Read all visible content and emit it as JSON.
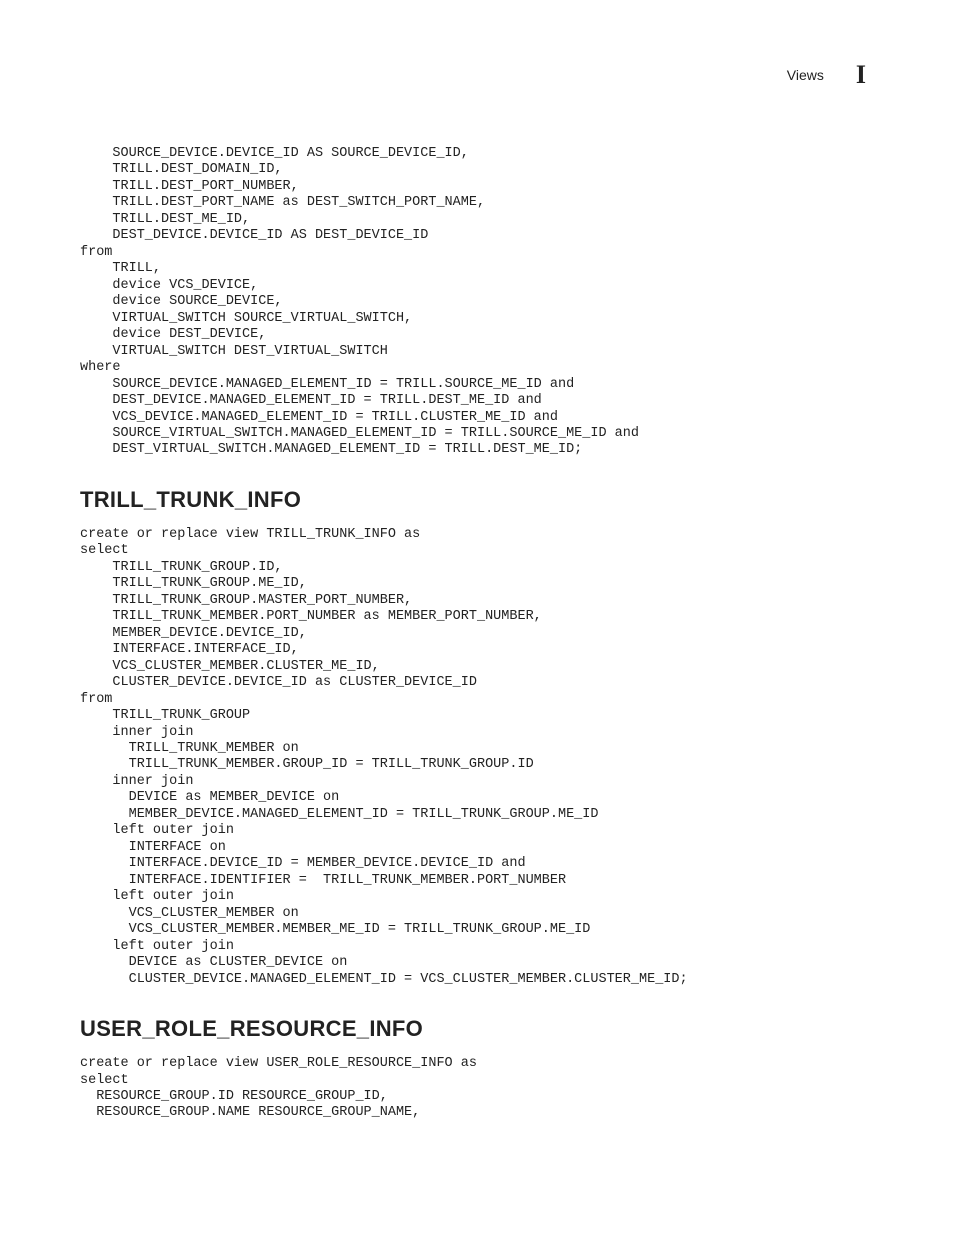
{
  "header": {
    "section": "Views",
    "appendix_letter": "I"
  },
  "code_block_1": "    SOURCE_DEVICE.DEVICE_ID AS SOURCE_DEVICE_ID,\n    TRILL.DEST_DOMAIN_ID,\n    TRILL.DEST_PORT_NUMBER,\n    TRILL.DEST_PORT_NAME as DEST_SWITCH_PORT_NAME,\n    TRILL.DEST_ME_ID,\n    DEST_DEVICE.DEVICE_ID AS DEST_DEVICE_ID\nfrom\n    TRILL,\n    device VCS_DEVICE,\n    device SOURCE_DEVICE,\n    VIRTUAL_SWITCH SOURCE_VIRTUAL_SWITCH,\n    device DEST_DEVICE,\n    VIRTUAL_SWITCH DEST_VIRTUAL_SWITCH\nwhere\n    SOURCE_DEVICE.MANAGED_ELEMENT_ID = TRILL.SOURCE_ME_ID and\n    DEST_DEVICE.MANAGED_ELEMENT_ID = TRILL.DEST_ME_ID and\n    VCS_DEVICE.MANAGED_ELEMENT_ID = TRILL.CLUSTER_ME_ID and\n    SOURCE_VIRTUAL_SWITCH.MANAGED_ELEMENT_ID = TRILL.SOURCE_ME_ID and\n    DEST_VIRTUAL_SWITCH.MANAGED_ELEMENT_ID = TRILL.DEST_ME_ID;",
  "heading_1": "TRILL_TRUNK_INFO",
  "code_block_2": "create or replace view TRILL_TRUNK_INFO as\nselect\n    TRILL_TRUNK_GROUP.ID,\n    TRILL_TRUNK_GROUP.ME_ID,\n    TRILL_TRUNK_GROUP.MASTER_PORT_NUMBER,\n    TRILL_TRUNK_MEMBER.PORT_NUMBER as MEMBER_PORT_NUMBER,\n    MEMBER_DEVICE.DEVICE_ID,\n    INTERFACE.INTERFACE_ID,\n    VCS_CLUSTER_MEMBER.CLUSTER_ME_ID,\n    CLUSTER_DEVICE.DEVICE_ID as CLUSTER_DEVICE_ID\nfrom\n    TRILL_TRUNK_GROUP\n    inner join\n      TRILL_TRUNK_MEMBER on\n      TRILL_TRUNK_MEMBER.GROUP_ID = TRILL_TRUNK_GROUP.ID\n    inner join\n      DEVICE as MEMBER_DEVICE on\n      MEMBER_DEVICE.MANAGED_ELEMENT_ID = TRILL_TRUNK_GROUP.ME_ID\n    left outer join\n      INTERFACE on\n      INTERFACE.DEVICE_ID = MEMBER_DEVICE.DEVICE_ID and\n      INTERFACE.IDENTIFIER =  TRILL_TRUNK_MEMBER.PORT_NUMBER\n    left outer join\n      VCS_CLUSTER_MEMBER on\n      VCS_CLUSTER_MEMBER.MEMBER_ME_ID = TRILL_TRUNK_GROUP.ME_ID\n    left outer join\n      DEVICE as CLUSTER_DEVICE on\n      CLUSTER_DEVICE.MANAGED_ELEMENT_ID = VCS_CLUSTER_MEMBER.CLUSTER_ME_ID;",
  "heading_2": "USER_ROLE_RESOURCE_INFO",
  "code_block_3": "create or replace view USER_ROLE_RESOURCE_INFO as\nselect\n  RESOURCE_GROUP.ID RESOURCE_GROUP_ID,\n  RESOURCE_GROUP.NAME RESOURCE_GROUP_NAME,"
}
